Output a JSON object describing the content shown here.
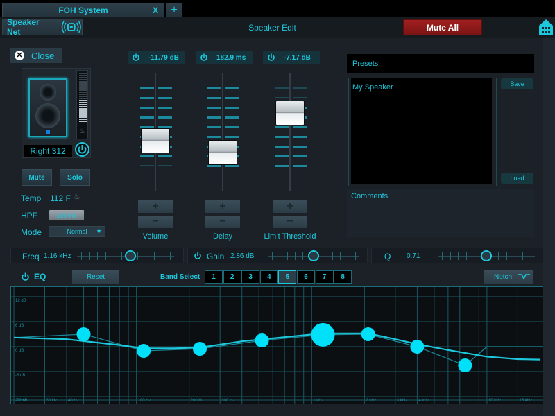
{
  "tabs": [
    {
      "label": "FOH System",
      "close": "X"
    },
    {
      "label": "+"
    }
  ],
  "header": {
    "speaker_net_label": "Speaker Net",
    "title": "Speaker Edit",
    "mute_all_label": "Mute All"
  },
  "speaker": {
    "close_label": "Close",
    "close_glyph": "✕",
    "name": "Right 312",
    "level_meter_fraction": 0.45,
    "mute_label": "Mute",
    "solo_label": "Solo",
    "temp_label": "Temp",
    "temp_value": "112 F",
    "hpf_label": "HPF",
    "hpf_value": "100 Hz",
    "mode_label": "Mode",
    "mode_value": "Normal",
    "mode_arrow": "▼"
  },
  "faders": [
    {
      "label": "Volume",
      "readout": "-11.79 dB",
      "position_fraction": 0.55
    },
    {
      "label": "Delay",
      "readout": "182.9 ms",
      "position_fraction": 0.45
    },
    {
      "label": "Limit Threshold",
      "readout": "-7.17 dB",
      "position_fraction": 0.78
    }
  ],
  "fader_buttons": {
    "plus": "+",
    "minus": "−"
  },
  "presets": {
    "header": "Presets",
    "items": [
      "My Speaker"
    ],
    "save_label": "Save",
    "load_label": "Load",
    "comments_label": "Comments"
  },
  "params": {
    "freq": {
      "label": "Freq",
      "value": "1.16 kHz",
      "position_fraction": 0.55
    },
    "gain": {
      "label": "Gain",
      "value": "2.86 dB",
      "position_fraction": 0.5
    },
    "q": {
      "label": "Q",
      "value": "0.71",
      "position_fraction": 0.5
    }
  },
  "eq": {
    "label": "EQ",
    "reset_label": "Reset",
    "band_select_label": "Band Select",
    "bands": [
      "1",
      "2",
      "3",
      "4",
      "5",
      "6",
      "7",
      "8"
    ],
    "selected_band": "5",
    "filter_type": "Notch",
    "db_labels": [
      "12 dB",
      "6 dB",
      "0 dB",
      "-6 dB",
      "-12 dB"
    ],
    "freq_labels": [
      "20 Hz",
      "30 Hz",
      "40 Hz",
      "100 Hz",
      "200 Hz",
      "300 Hz",
      "1 kHz",
      "2 kHz",
      "3 kHz",
      "4 kHz",
      "10 kHz",
      "15 kHz"
    ],
    "band_points": [
      {
        "band": "1",
        "freq_hz": 50,
        "gain_db": 3.0
      },
      {
        "band": "2",
        "freq_hz": 110,
        "gain_db": -1.0
      },
      {
        "band": "3",
        "freq_hz": 230,
        "gain_db": -0.5
      },
      {
        "band": "4",
        "freq_hz": 520,
        "gain_db": 1.5
      },
      {
        "band": "5",
        "freq_hz": 1160,
        "gain_db": 2.86
      },
      {
        "band": "6",
        "freq_hz": 2100,
        "gain_db": 3.0
      },
      {
        "band": "7",
        "freq_hz": 4000,
        "gain_db": 0.0
      },
      {
        "band": "8",
        "freq_hz": 7500,
        "gain_db": -4.5
      }
    ],
    "curve_db": [
      [
        20,
        2.2
      ],
      [
        40,
        1.8
      ],
      [
        80,
        0.4
      ],
      [
        110,
        -0.4
      ],
      [
        160,
        -0.4
      ],
      [
        230,
        -0.2
      ],
      [
        400,
        1.3
      ],
      [
        700,
        2.3
      ],
      [
        1160,
        3.2
      ],
      [
        2100,
        3.2
      ],
      [
        3000,
        1.8
      ],
      [
        4000,
        0.6
      ],
      [
        6000,
        -0.8
      ],
      [
        10000,
        -2.4
      ],
      [
        15000,
        -3.0
      ],
      [
        20000,
        -3.1
      ]
    ]
  },
  "colors": {
    "accent": "#1ec8dc",
    "mute_all": "#a12020",
    "background": "#1c2128"
  }
}
